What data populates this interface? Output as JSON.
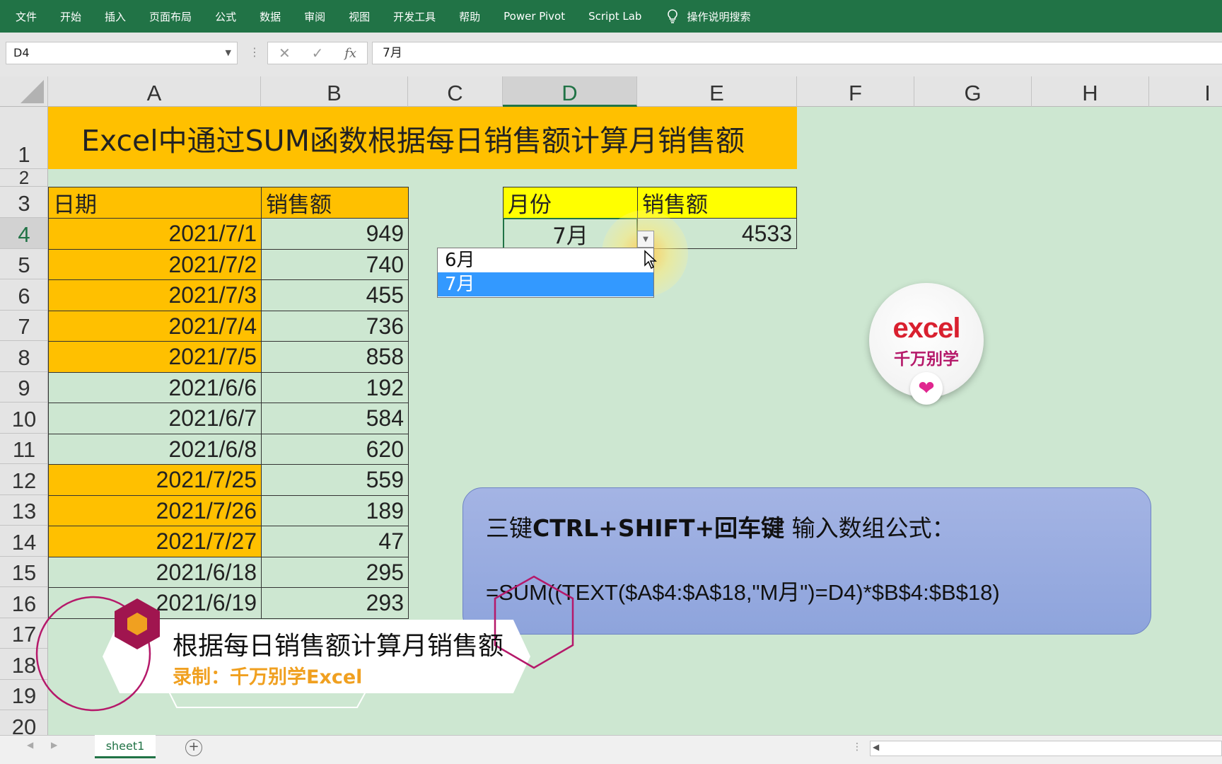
{
  "ribbon": {
    "tabs": [
      "文件",
      "开始",
      "插入",
      "页面布局",
      "公式",
      "数据",
      "审阅",
      "视图",
      "开发工具",
      "帮助",
      "Power Pivot",
      "Script Lab"
    ],
    "tell_me": "操作说明搜索"
  },
  "formula_bar": {
    "name_box": "D4",
    "cancel": "✕",
    "enter": "✓",
    "fx": "fx",
    "value": "7月"
  },
  "columns": [
    "A",
    "B",
    "C",
    "D",
    "E",
    "F",
    "G",
    "H",
    "I"
  ],
  "selected_column": "D",
  "rows": [
    "1",
    "2",
    "3",
    "4",
    "5",
    "6",
    "7",
    "8",
    "9",
    "10",
    "11",
    "12",
    "13",
    "14",
    "15",
    "16",
    "17",
    "18",
    "19",
    "20"
  ],
  "selected_row": "4",
  "sheet": {
    "title": "Excel中通过SUM函数根据每日销售额计算月销售额",
    "table_headers": {
      "date": "日期",
      "sales": "销售额"
    },
    "table_rows": [
      {
        "date": "2021/7/1",
        "sales": "949",
        "highlight": true
      },
      {
        "date": "2021/7/2",
        "sales": "740",
        "highlight": true
      },
      {
        "date": "2021/7/3",
        "sales": "455",
        "highlight": true
      },
      {
        "date": "2021/7/4",
        "sales": "736",
        "highlight": true
      },
      {
        "date": "2021/7/5",
        "sales": "858",
        "highlight": true
      },
      {
        "date": "2021/6/6",
        "sales": "192",
        "highlight": false
      },
      {
        "date": "2021/6/7",
        "sales": "584",
        "highlight": false
      },
      {
        "date": "2021/6/8",
        "sales": "620",
        "highlight": false
      },
      {
        "date": "2021/7/25",
        "sales": "559",
        "highlight": true
      },
      {
        "date": "2021/7/26",
        "sales": "189",
        "highlight": true
      },
      {
        "date": "2021/7/27",
        "sales": "47",
        "highlight": true
      },
      {
        "date": "2021/6/18",
        "sales": "295",
        "highlight": false
      },
      {
        "date": "2021/6/19",
        "sales": "293",
        "highlight": false
      }
    ],
    "summary_headers": {
      "month": "月份",
      "sales": "销售额"
    },
    "summary_values": {
      "month": "7月",
      "sales": "4533"
    }
  },
  "dropdown": {
    "options": [
      "6月",
      "7月"
    ],
    "selected": "7月"
  },
  "logo": {
    "line1": "excel",
    "line2": "千万别学",
    "heart": "❤"
  },
  "note": {
    "prefix": "三键",
    "keys": "CTRL+SHIFT+回车键",
    "suffix": " 输入数组公式：",
    "formula": "=SUM((TEXT($A$4:$A$18,\"M月\")=D4)*$B$4:$B$18)"
  },
  "caption": {
    "title": "根据每日销售额计算月销售额",
    "subtitle": "录制：千万别学Excel"
  },
  "tabs": {
    "sheet": "sheet1",
    "add": "+"
  },
  "colors": {
    "excel_green": "#217346",
    "sheet_bg": "#cde7d1",
    "orange": "#ffc000",
    "yellow": "#ffff00",
    "dropdown_selected": "#3399ff"
  }
}
